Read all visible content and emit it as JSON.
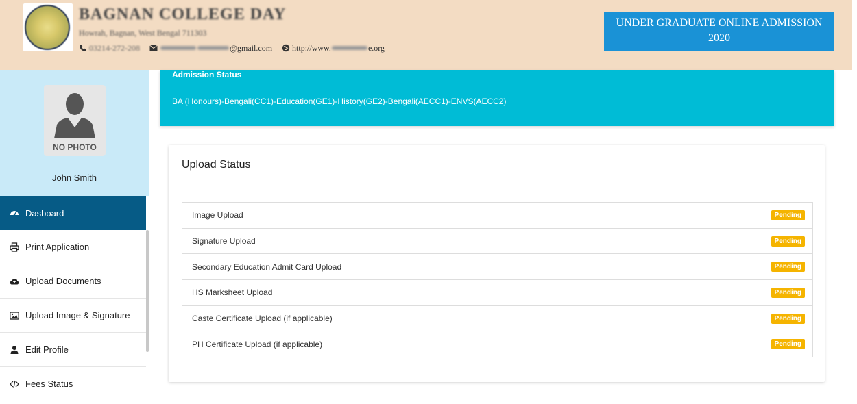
{
  "header": {
    "college_name": "BAGNAN COLLEGE DAY",
    "address": "Howrah, Bagnan, West Bengal 711303",
    "phone": "03214-272-208",
    "email_suffix": "@gmail.com",
    "web_prefix": "http://www.",
    "web_suffix": "e.org",
    "banner_line1": "UNDER GRADUATE ONLINE ADMISSION",
    "banner_line2": "2020"
  },
  "profile": {
    "no_photo_label": "NO PHOTO",
    "name": "John Smith"
  },
  "nav": {
    "items": [
      {
        "label": "Dasboard",
        "icon": "dashboard-icon",
        "active": true
      },
      {
        "label": "Print Application",
        "icon": "print-icon"
      },
      {
        "label": "Upload Documents",
        "icon": "cloud-upload-icon"
      },
      {
        "label": "Upload Image & Signature",
        "icon": "image-icon"
      },
      {
        "label": "Edit Profile",
        "icon": "user-icon"
      },
      {
        "label": "Fees Status",
        "icon": "code-icon"
      }
    ]
  },
  "admission": {
    "title": "Admission Status",
    "course": "BA (Honours)-Bengali(CC1)-Education(GE1)-History(GE2)-Bengali(AECC1)-ENVS(AECC2)"
  },
  "upload": {
    "title": "Upload Status",
    "rows": [
      {
        "label": "Image Upload",
        "status": "Pending"
      },
      {
        "label": "Signature Upload",
        "status": "Pending"
      },
      {
        "label": "Secondary Education Admit Card Upload",
        "status": "Pending"
      },
      {
        "label": "HS Marksheet Upload",
        "status": "Pending"
      },
      {
        "label": "Caste Certificate Upload (if applicable)",
        "status": "Pending"
      },
      {
        "label": "PH Certificate Upload (if applicable)",
        "status": "Pending"
      }
    ]
  },
  "colors": {
    "header_bg": "#f3dcc3",
    "banner_blue": "#1a92d6",
    "active_nav": "#065b86",
    "status_cyan": "#00bcd6",
    "badge_pending": "#f5b400"
  }
}
